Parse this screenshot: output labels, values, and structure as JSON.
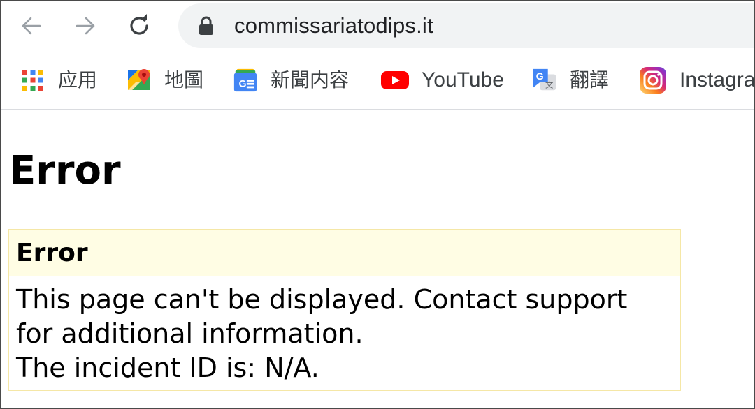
{
  "toolbar": {
    "url": "commissariatodips.it"
  },
  "icons": {
    "back": "arrow-left-icon",
    "forward": "arrow-right-icon",
    "reload": "reload-icon",
    "lock": "lock-icon"
  },
  "bookmarks": [
    {
      "label": "应用",
      "icon": "apps-grid-icon"
    },
    {
      "label": "地圖",
      "icon": "google-maps-icon"
    },
    {
      "label": "新聞内容",
      "icon": "google-news-icon"
    },
    {
      "label": "YouTube",
      "icon": "youtube-icon"
    },
    {
      "label": "翻譯",
      "icon": "google-translate-icon"
    },
    {
      "label": "Instagram",
      "icon": "instagram-icon"
    }
  ],
  "page": {
    "title": "Error",
    "box": {
      "heading": "Error",
      "message": "This page can't be displayed. Contact support for additional information.",
      "incident": "The incident ID is: N/A."
    }
  },
  "colors": {
    "omnibox_bg": "#f1f3f4",
    "box_header_bg": "#fffde4",
    "box_border": "#f5e7a6",
    "youtube_red": "#ff0000"
  }
}
